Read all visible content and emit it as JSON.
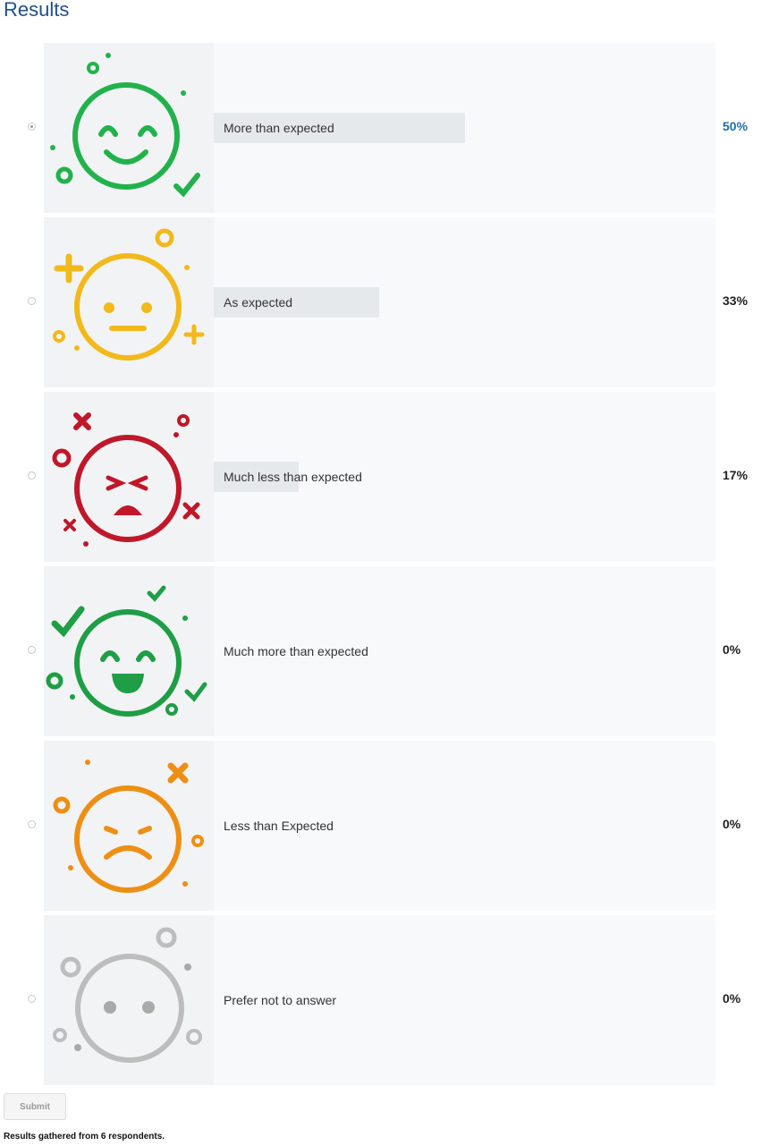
{
  "title": "Results",
  "options": [
    {
      "label": "More than expected",
      "percent": "50%",
      "share": 0.5,
      "selected": true,
      "icon": "happy-face-icon",
      "color": "#22b24c"
    },
    {
      "label": "As expected",
      "percent": "33%",
      "share": 0.33,
      "selected": false,
      "icon": "neutral-face-icon",
      "color": "#f2b91c"
    },
    {
      "label": "Much less than expected",
      "percent": "17%",
      "share": 0.17,
      "selected": false,
      "icon": "angry-face-icon",
      "color": "#c0172a"
    },
    {
      "label": "Much more than expected",
      "percent": "0%",
      "share": 0,
      "selected": false,
      "icon": "laughing-face-icon",
      "color": "#1e9e45"
    },
    {
      "label": "Less than Expected",
      "percent": "0%",
      "share": 0,
      "selected": false,
      "icon": "sad-face-icon",
      "color": "#ee8f15"
    },
    {
      "label": "Prefer not to answer",
      "percent": "0%",
      "share": 0,
      "selected": false,
      "icon": "blank-face-icon",
      "color": "#bdbdbd"
    }
  ],
  "submit_label": "Submit",
  "footer": "Results gathered from 6 respondents.",
  "colors": {
    "title": "#1e4f8a",
    "leading_percent": "#1a6fa5",
    "bar": "#e6e9ec"
  }
}
